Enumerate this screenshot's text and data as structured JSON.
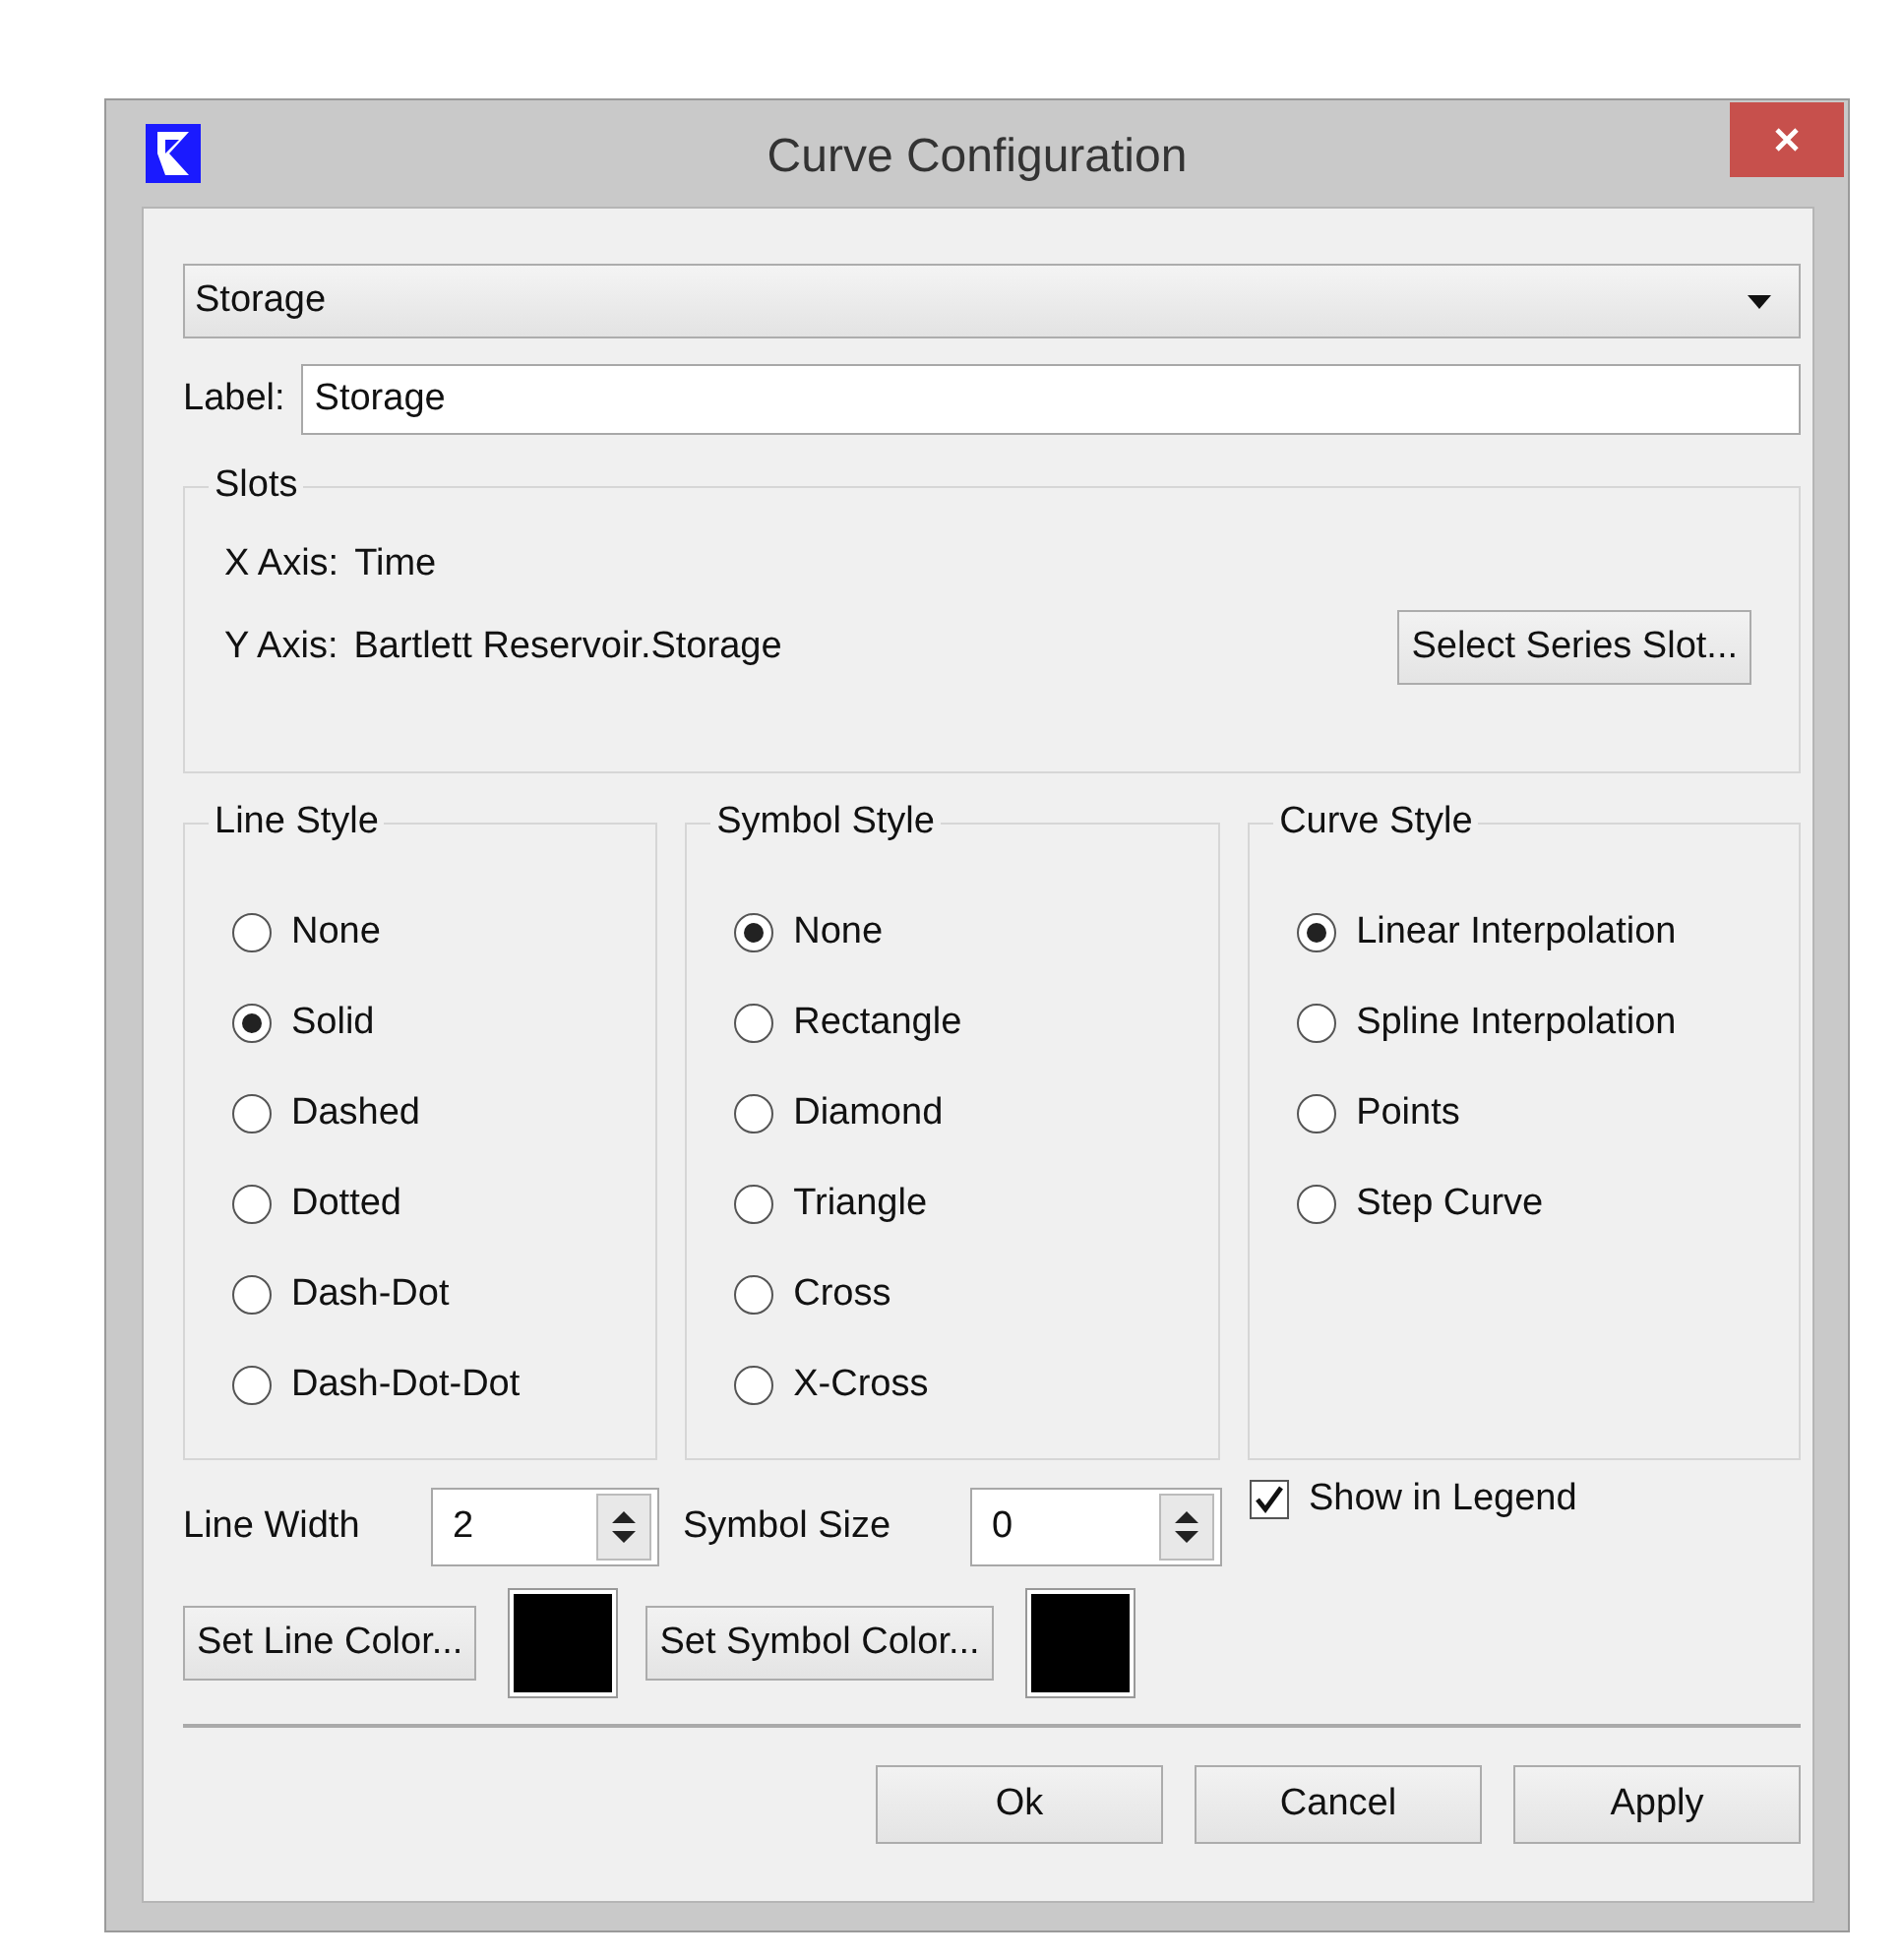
{
  "window": {
    "title": "Curve Configuration"
  },
  "curve_select": {
    "value": "Storage"
  },
  "label_field": {
    "label": "Label:",
    "value": "Storage"
  },
  "slots": {
    "title": "Slots",
    "x_axis": {
      "label": "X Axis:",
      "value": "Time"
    },
    "y_axis": {
      "label": "Y Axis:",
      "value": "Bartlett Reservoir.Storage"
    },
    "button": "Select Series Slot..."
  },
  "groups": [
    {
      "title": "Line Style",
      "options": [
        {
          "label": "None",
          "selected": false
        },
        {
          "label": "Solid",
          "selected": true
        },
        {
          "label": "Dashed",
          "selected": false
        },
        {
          "label": "Dotted",
          "selected": false
        },
        {
          "label": "Dash-Dot",
          "selected": false
        },
        {
          "label": "Dash-Dot-Dot",
          "selected": false
        }
      ]
    },
    {
      "title": "Symbol Style",
      "options": [
        {
          "label": "None",
          "selected": true
        },
        {
          "label": "Rectangle",
          "selected": false
        },
        {
          "label": "Diamond",
          "selected": false
        },
        {
          "label": "Triangle",
          "selected": false
        },
        {
          "label": "Cross",
          "selected": false
        },
        {
          "label": "X-Cross",
          "selected": false
        }
      ]
    },
    {
      "title": "Curve Style",
      "options": [
        {
          "label": "Linear Interpolation",
          "selected": true
        },
        {
          "label": "Spline Interpolation",
          "selected": false
        },
        {
          "label": "Points",
          "selected": false
        },
        {
          "label": "Step Curve",
          "selected": false
        }
      ]
    }
  ],
  "line_width": {
    "label": "Line Width",
    "value": "2"
  },
  "symbol_size": {
    "label": "Symbol Size",
    "value": "0"
  },
  "show_in_legend": {
    "label": "Show in Legend",
    "checked": true
  },
  "line_color": {
    "button": "Set Line Color...",
    "color": "#000000"
  },
  "symbol_color": {
    "button": "Set Symbol Color...",
    "color": "#000000"
  },
  "buttons": [
    "Ok",
    "Cancel",
    "Apply"
  ]
}
